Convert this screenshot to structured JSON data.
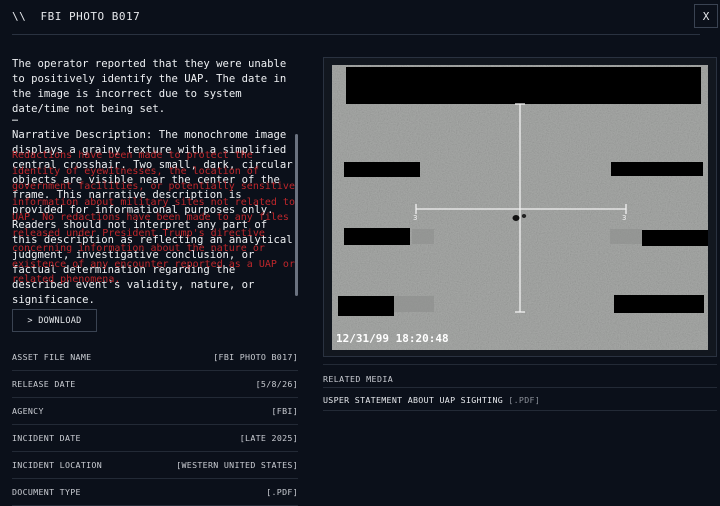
{
  "header": {
    "prefix": "\\\\",
    "title": "FBI PHOTO B017",
    "close_label": "X"
  },
  "intro_text": "The operator reported that they were unable to positively identify the UAP. The date in the image is incorrect due to system date/time not being set.",
  "ellipsis": "…",
  "narrative": "Narrative Description: The monochrome image displays a grainy texture with a simplified central crosshair. Two small, dark, circular objects are visible near the center of the frame. This narrative description is provided for informational purposes only. Readers should not interpret any part of this description as reflecting an analytical judgment, investigative conclusion, or factual determination regarding the described event's validity, nature, or significance.",
  "redaction_notice": "Redactions have been made to protect the identity of eyewitnesses, the location of government facilities, or potentially sensitive information about military sites not related to UAP. No redactions have been made to any files released under President Trump's directive concerning information about the nature or existence of any encounter reported as a UAP or related phenomena.",
  "download_label": "> DOWNLOAD",
  "metadata": [
    {
      "key": "ASSET FILE NAME",
      "value": "[FBI PHOTO B017]"
    },
    {
      "key": "RELEASE DATE",
      "value": "[5/8/26]"
    },
    {
      "key": "AGENCY",
      "value": "[FBI]"
    },
    {
      "key": "INCIDENT DATE",
      "value": "[LATE 2025]"
    },
    {
      "key": "INCIDENT LOCATION",
      "value": "[WESTERN UNITED STATES]"
    },
    {
      "key": "DOCUMENT TYPE",
      "value": "[.PDF]"
    }
  ],
  "image": {
    "timestamp": "12/31/99 18:20:48",
    "tick_left": "3",
    "tick_right": "3"
  },
  "related_media": {
    "title": "RELATED MEDIA",
    "item_label": "USPER STATEMENT ABOUT UAP SIGHTING",
    "item_ext": "[.PDF]"
  },
  "colors": {
    "background": "#0b101a",
    "redaction_text": "#c7282c",
    "border": "#2a3240"
  }
}
